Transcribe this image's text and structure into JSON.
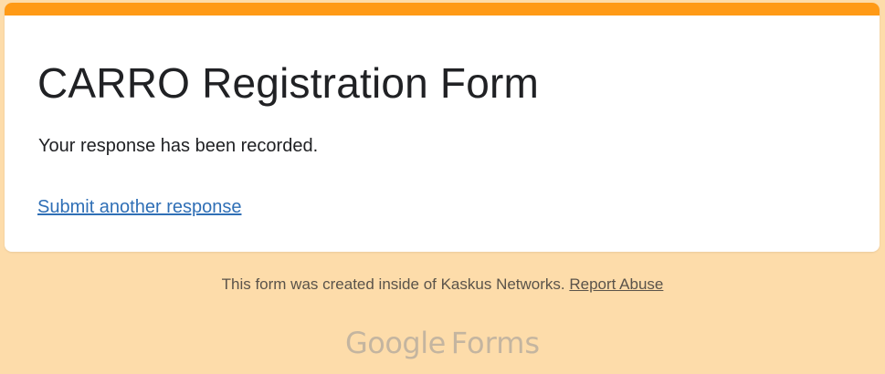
{
  "card": {
    "accent_color": "#ff9a16",
    "title": "CARRO Registration Form",
    "confirmation": "Your response has been recorded.",
    "submit_another_label": "Submit another response"
  },
  "footer": {
    "note": "This form was created inside of Kaskus Networks.",
    "report_abuse_label": "Report Abuse",
    "brand_google": "Google",
    "brand_forms": "Forms"
  },
  "colors": {
    "page_background": "#fddcaa",
    "link": "#2f6fb6"
  }
}
